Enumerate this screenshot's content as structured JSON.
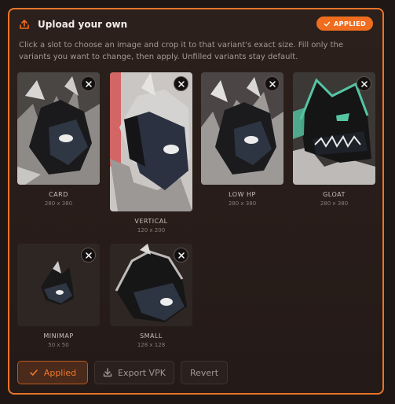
{
  "header": {
    "title": "Upload your own",
    "badge": "APPLIED"
  },
  "description": "Click a slot to choose an image and crop it to that variant's exact size. Fill only the variants you want to change, then apply. Unfilled variants stay default.",
  "slots": [
    {
      "name": "CARD",
      "size": "280 x 380",
      "icon": "close-icon",
      "accent": "#ffffff"
    },
    {
      "name": "VERTICAL",
      "size": "120 x 200",
      "icon": "close-icon",
      "accent": "#d46565"
    },
    {
      "name": "LOW HP",
      "size": "280 x 380",
      "icon": "close-icon",
      "accent": "#ffffff"
    },
    {
      "name": "GLOAT",
      "size": "280 x 380",
      "icon": "close-icon",
      "accent": "#55c5a4"
    },
    {
      "name": "MINIMAP",
      "size": "50 x 50",
      "icon": "close-icon",
      "accent": "#ffffff"
    },
    {
      "name": "SMALL",
      "size": "128 x 128",
      "icon": "close-icon",
      "accent": "#ffffff"
    }
  ],
  "buttons": {
    "applied": "Applied",
    "export": "Export VPK",
    "revert": "Revert"
  },
  "colors": {
    "accent": "#e8742a",
    "badge": "#f06d1f",
    "background": "#241a17"
  }
}
